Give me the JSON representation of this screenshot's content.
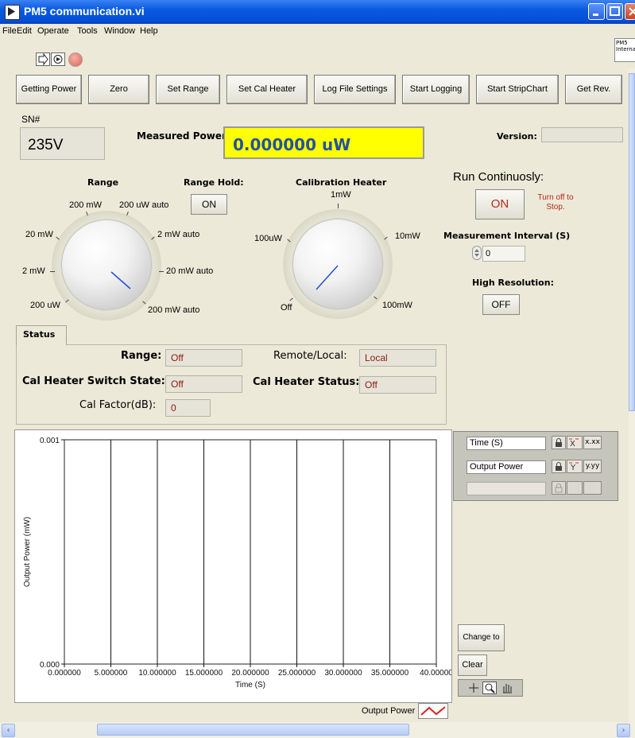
{
  "window": {
    "title": "PM5 communication.vi"
  },
  "menu": [
    {
      "key": "file",
      "label": "File"
    },
    {
      "key": "edit",
      "label": "Edit"
    },
    {
      "key": "operate",
      "label": "Operate"
    },
    {
      "key": "tools",
      "label": "Tools"
    },
    {
      "key": "window",
      "label": "Window"
    },
    {
      "key": "help",
      "label": "Help"
    }
  ],
  "logo_text": "PM5 Interna",
  "top_buttons": [
    "Getting Power",
    "Zero",
    "Set Range",
    "Set Cal Heater",
    "Log File Settings",
    "Start Logging",
    "Start StripChart",
    "Get Rev."
  ],
  "sn": {
    "label": "SN#",
    "value": "235V"
  },
  "measured_power": {
    "label": "Measured Power",
    "value": "0.000000 uW"
  },
  "version": {
    "label": "Version:",
    "value": ""
  },
  "range": {
    "label": "Range",
    "knob_labels": [
      "200 mW",
      "200 uW auto",
      "20 mW",
      "2 mW auto",
      "2 mW",
      "20 mW auto",
      "200 uW",
      "200 mW auto"
    ]
  },
  "range_hold": {
    "label": "Range Hold:",
    "value": "ON"
  },
  "cal_heater": {
    "label": "Calibration Heater",
    "knob_labels": [
      "1mW",
      "100uW",
      "10mW",
      "Off",
      "100mW"
    ]
  },
  "run_continuously": {
    "label": "Run Continuosly:",
    "button": "ON",
    "hint": "Turn off to Stop."
  },
  "measurement_interval": {
    "label": "Measurement Interval (S)",
    "value": "0"
  },
  "high_resolution": {
    "label": "High Resolution:",
    "value": "OFF"
  },
  "status": {
    "tab": "Status",
    "range_label": "Range:",
    "range_value": "Off",
    "remote_label": "Remote/Local:",
    "remote_value": "Local",
    "switch_label": "Cal Heater Switch State:",
    "switch_value": "Off",
    "heater_status_label": "Cal Heater Status:",
    "heater_status_value": "Off",
    "cal_factor_label": "Cal Factor(dB):",
    "cal_factor_value": "0"
  },
  "chart_data": {
    "type": "line",
    "xlabel": "Time (S)",
    "ylabel": "Output Power (mW)",
    "xlim": [
      0,
      40
    ],
    "ylim": [
      0,
      0.001
    ],
    "x_ticks": [
      "0.000000",
      "5.000000",
      "10.000000",
      "15.000000",
      "20.000000",
      "25.000000",
      "30.000000",
      "35.000000",
      "40.00000"
    ],
    "y_ticks": [
      "0.000",
      "0.001"
    ],
    "grid": "vertical",
    "series": [
      {
        "name": "Output Power",
        "values": []
      }
    ]
  },
  "scales_legend": {
    "x_name": "Time (S)",
    "x_format": "x.xx",
    "y_name": "Output Power",
    "y_format": "y.yy"
  },
  "side_buttons": {
    "change": "Change to uW",
    "clear": "Clear"
  },
  "plot_legend_label": "Output Power",
  "colors": {
    "measured_bg": "#ffff00",
    "measured_text": "#2552a0",
    "plot_line": "#e02020",
    "indicator_text": "#8b1a10"
  }
}
